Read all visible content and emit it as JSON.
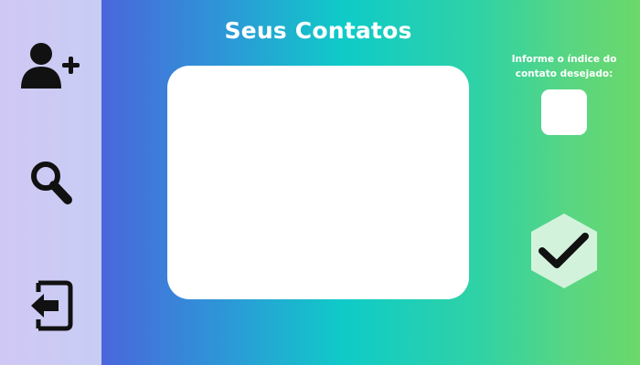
{
  "app": {
    "title": "Seus Contatos"
  },
  "sidebar": {
    "items": [
      {
        "name": "add-contact",
        "icon": "user-plus-icon"
      },
      {
        "name": "search",
        "icon": "magnifier-icon"
      },
      {
        "name": "exit",
        "icon": "sign-out-icon"
      }
    ]
  },
  "index_prompt": {
    "label": "Informe o índice do contato desejado:",
    "value": ""
  },
  "confirm": {
    "icon": "check-icon"
  },
  "colors": {
    "sidebar_bg": "#cbcbf4",
    "gradient_left": "#4a66dc",
    "gradient_mid": "#0fcbc8",
    "gradient_right": "#6bd86a",
    "panel_bg": "#ffffff",
    "confirm_bg": "#d2f2dc",
    "icon": "#111111"
  }
}
